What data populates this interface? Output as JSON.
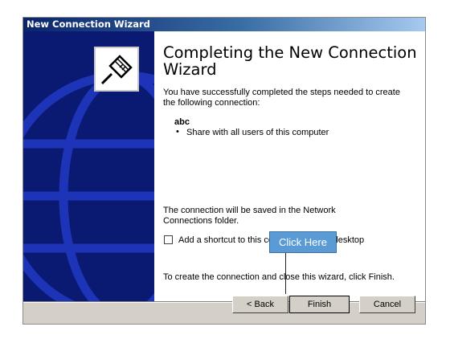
{
  "window": {
    "title": "New Connection Wizard"
  },
  "content": {
    "heading": "Completing the New Connection Wizard",
    "intro": "You have successfully completed the steps needed to create the following connection:",
    "connection_name": "abc",
    "bullet": "Share with all users of this computer",
    "saved_note": "The connection will be saved in the Network Connections folder.",
    "shortcut_label": "Add a shortcut to this connection to my desktop",
    "shortcut_checked": false,
    "finish_note": "To create the connection and close this wizard, click Finish."
  },
  "buttons": {
    "back": "< Back",
    "finish": "Finish",
    "cancel": "Cancel"
  },
  "callout": {
    "label": "Click Here"
  },
  "colors": {
    "title_bar": "#0a246a",
    "side_panel": "#0a1a72",
    "globe": "#1e34b8",
    "callout": "#5b9bd5",
    "dialog_bg": "#d4d0c8"
  },
  "icons": {
    "wizard_icon": "network-plug-icon",
    "side_art": "globe-icon"
  }
}
